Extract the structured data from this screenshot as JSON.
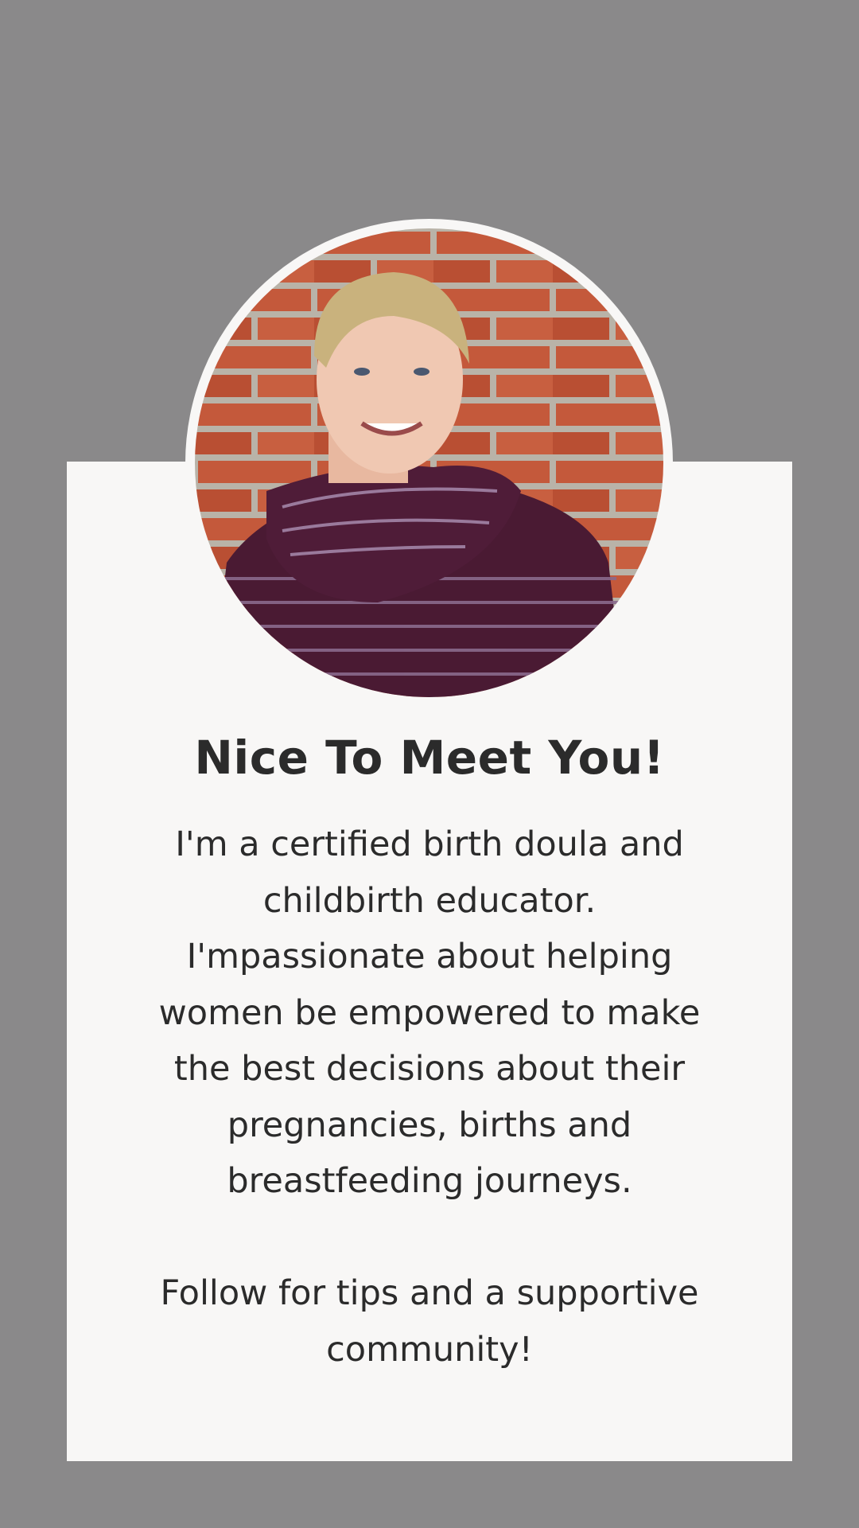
{
  "profile": {
    "photo": "portrait of a smiling woman with short blonde hair wearing a purple striped cowl-neck top in front of a red brick wall",
    "title": "Nice To Meet You!",
    "bio_lines": [
      "I'm a certified birth doula and",
      "childbirth educator.",
      "I'mpassionate about helping",
      "women be empowered to make",
      "the best decisions about their",
      "pregnancies, births and",
      "breastfeeding journeys.",
      "",
      "Follow for tips and a supportive",
      "community!"
    ]
  },
  "colors": {
    "background": "#8a898a",
    "card": "#f8f7f6",
    "text": "#2b2b2b",
    "brick": "#c0583a",
    "top": "#4a1a33"
  }
}
